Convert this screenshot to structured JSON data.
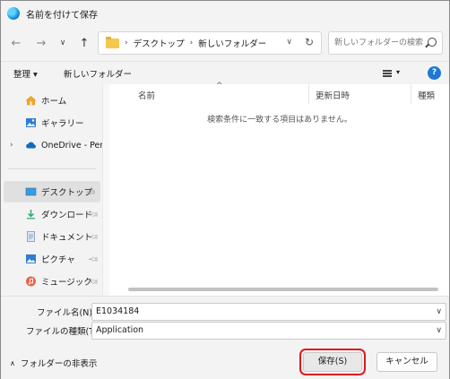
{
  "window": {
    "title": "名前を付けて保存"
  },
  "nav": {
    "back": "←",
    "forward": "→",
    "recent": "∨",
    "up": "↑",
    "breadcrumbs": [
      "デスクトップ",
      "新しいフォルダー"
    ],
    "search_placeholder": "新しいフォルダーの検索"
  },
  "toolbar": {
    "organize": "整理 ▾",
    "new_folder": "新しいフォルダー",
    "help": "?"
  },
  "sidebar": {
    "items": [
      {
        "label": "ホーム",
        "icon": "home-icon"
      },
      {
        "label": "ギャラリー",
        "icon": "gallery-icon"
      },
      {
        "label": "OneDrive - Perso",
        "icon": "onedrive-icon"
      },
      {
        "label": "デスクトップ",
        "icon": "desktop-icon",
        "selected": true
      },
      {
        "label": "ダウンロード",
        "icon": "download-icon"
      },
      {
        "label": "ドキュメント",
        "icon": "documents-icon"
      },
      {
        "label": "ピクチャ",
        "icon": "pictures-icon"
      },
      {
        "label": "ミュージック",
        "icon": "music-icon"
      }
    ]
  },
  "filelist": {
    "columns": [
      "名前",
      "更新日時",
      "種類"
    ],
    "empty_message": "検索条件に一致する項目はありません。"
  },
  "footer": {
    "filename_label": "ファイル名(N):",
    "filename_value": "E1034184",
    "filetype_label": "ファイルの種類(T):",
    "filetype_value": "Application",
    "hide_folders": "フォルダーの非表示",
    "save_button": "保存(S)",
    "cancel_button": "キャンセル"
  },
  "colors": {
    "accent": "#1e78d6",
    "highlight_border": "#e0171f"
  }
}
